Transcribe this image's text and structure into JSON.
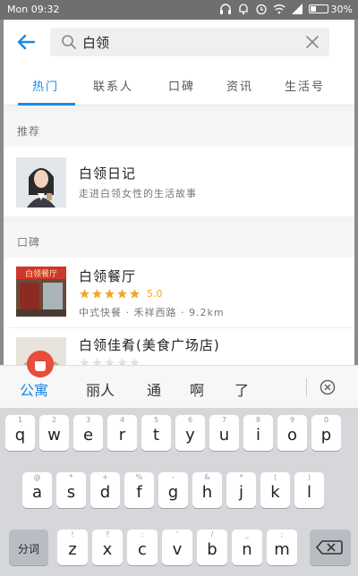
{
  "status": {
    "time": "Mon 09:32",
    "battery": "30%",
    "battery_level": 0.3
  },
  "search": {
    "query": "白领"
  },
  "tabs": [
    {
      "label": "热门",
      "active": true
    },
    {
      "label": "联系人"
    },
    {
      "label": "口碑"
    },
    {
      "label": "资讯"
    },
    {
      "label": "生活号"
    }
  ],
  "sections": {
    "recommend": "推荐",
    "koubei": "口碑"
  },
  "recommend_item": {
    "title": "白领日记",
    "subtitle": "走进白领女性的生活故事"
  },
  "koubei_items": [
    {
      "title": "白领餐厅",
      "rating": "5.0",
      "stars": 5,
      "meta": "中式快餐 · 禾祥西路 · 9.2km",
      "sign": "白领餐厅"
    },
    {
      "title": "白领佳肴(美食广场店)",
      "rating": "",
      "stars": 0,
      "meta": ""
    }
  ],
  "suggestions": [
    "公寓",
    "丽人",
    "通",
    "啊",
    "了"
  ],
  "keyboard": {
    "row1": [
      {
        "k": "q",
        "h": "1"
      },
      {
        "k": "w",
        "h": "2"
      },
      {
        "k": "e",
        "h": "3"
      },
      {
        "k": "r",
        "h": "4"
      },
      {
        "k": "t",
        "h": "5"
      },
      {
        "k": "y",
        "h": "6"
      },
      {
        "k": "u",
        "h": "7"
      },
      {
        "k": "i",
        "h": "8"
      },
      {
        "k": "o",
        "h": "9"
      },
      {
        "k": "p",
        "h": "0"
      }
    ],
    "row2": [
      {
        "k": "a",
        "h": "@"
      },
      {
        "k": "s",
        "h": "*"
      },
      {
        "k": "d",
        "h": "+"
      },
      {
        "k": "f",
        "h": "%"
      },
      {
        "k": "g",
        "h": "-"
      },
      {
        "k": "h",
        "h": "&"
      },
      {
        "k": "j",
        "h": "*"
      },
      {
        "k": "k",
        "h": "("
      },
      {
        "k": "l",
        "h": ")"
      }
    ],
    "row3": [
      {
        "k": "z",
        "h": "!"
      },
      {
        "k": "x",
        "h": "?"
      },
      {
        "k": "c",
        "h": ":"
      },
      {
        "k": "v",
        "h": "'"
      },
      {
        "k": "b",
        "h": "/"
      },
      {
        "k": "n",
        "h": "_"
      },
      {
        "k": "m",
        "h": ";"
      }
    ],
    "fenci": "分词"
  }
}
